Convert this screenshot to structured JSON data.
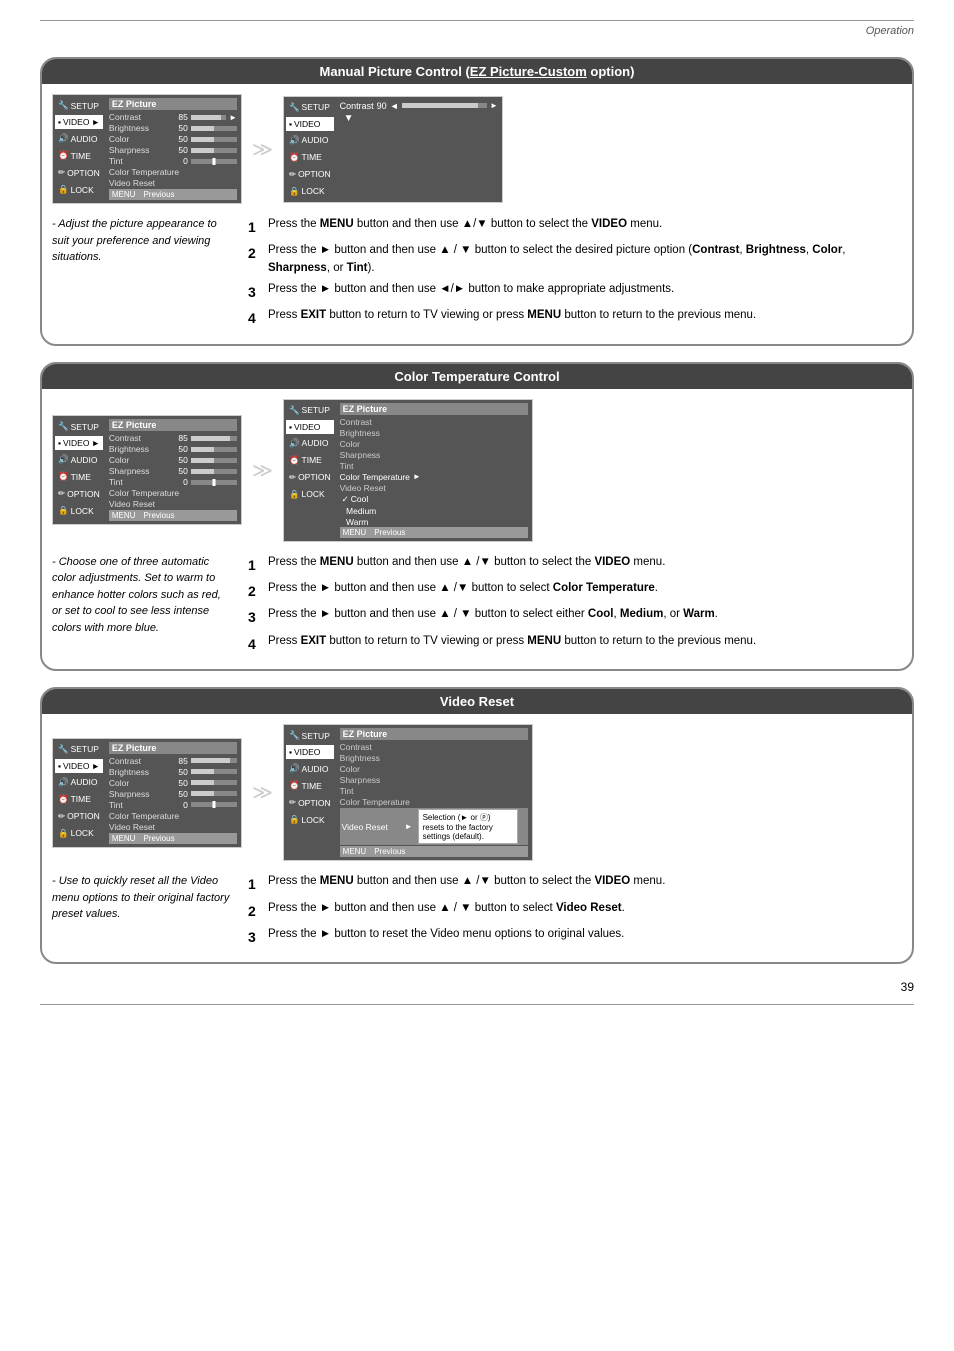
{
  "header": {
    "operation_label": "Operation"
  },
  "section1": {
    "title": "Manual Picture Control (EZ Picture-Custom option)",
    "left_panel": {
      "header": "EZ Picture",
      "rows": [
        {
          "label": "Contrast",
          "value": "85",
          "bar": 85
        },
        {
          "label": "Brightness",
          "value": "50",
          "bar": 50
        },
        {
          "label": "Color",
          "value": "50",
          "bar": 50
        },
        {
          "label": "Sharpness",
          "value": "50",
          "bar": 50
        },
        {
          "label": "Tint",
          "value": "0",
          "tint": true
        },
        {
          "label": "Color Temperature",
          "value": ""
        },
        {
          "label": "Video Reset",
          "value": ""
        }
      ],
      "bottom": [
        "MENU",
        "Previous"
      ],
      "sidebar": [
        {
          "label": "SETUP",
          "icon": "🔧"
        },
        {
          "label": "VIDEO",
          "selected": true
        },
        {
          "label": "AUDIO"
        },
        {
          "label": "TIME"
        },
        {
          "label": "OPTION"
        },
        {
          "label": "LOCK"
        }
      ]
    },
    "right_panel": {
      "contrast_label": "Contrast",
      "contrast_value": "90",
      "arrow_left": "◄",
      "arrow_right": "►",
      "bar_fill": 90,
      "down_arrow": "▼"
    },
    "side_note": "- Adjust the picture appearance to suit your preference and viewing situations.",
    "steps": [
      {
        "num": "1",
        "text": "Press the **MENU** button and then use ▲/▼ button to select the **VIDEO** menu."
      },
      {
        "num": "2",
        "text": "Press the ► button and then use ▲ / ▼ button to select the desired picture option (**Contrast**, **Brightness**, **Color**, **Sharpness**, or **Tint**)."
      },
      {
        "num": "3",
        "text": "Press the ► button and then use ◄/► button to make appropriate adjustments."
      },
      {
        "num": "4",
        "text": "Press **EXIT** button to return to TV viewing or press **MENU** button to return to the previous menu."
      }
    ]
  },
  "section2": {
    "title": "Color Temperature Control",
    "side_note": "- Choose one of three automatic color adjustments. Set to warm to enhance hotter colors such as red, or set to cool to see less intense colors with more blue.",
    "steps": [
      {
        "num": "1",
        "text": "Press the **MENU** button and then use ▲ /▼ button to select the **VIDEO** menu."
      },
      {
        "num": "2",
        "text": "Press the ► button and then use ▲ /▼ button to select **Color Temperature**."
      },
      {
        "num": "3",
        "text": "Press the ► button and then use ▲ / ▼ button to select either **Cool**, **Medium**, or **Warm**."
      },
      {
        "num": "4",
        "text": "Press **EXIT** button to return to TV viewing or press **MENU** button to return to the previous menu."
      }
    ],
    "right_options": [
      "✓ Cool",
      "Medium",
      "Warm"
    ]
  },
  "section3": {
    "title": "Video Reset",
    "side_note": "- Use to quickly reset all the Video menu options to their original factory preset values.",
    "steps": [
      {
        "num": "1",
        "text": "Press the **MENU** button and then use ▲ /▼ button to select the **VIDEO** menu."
      },
      {
        "num": "2",
        "text": "Press the ► button and then use ▲ / ▼ button to select **Video Reset**."
      },
      {
        "num": "3",
        "text": "Press the ► button to reset the Video menu options to original values."
      }
    ],
    "tooltip": "Selection (► or ⓟ) resets to the factory settings (default)."
  },
  "page_number": "39",
  "sidebar_labels": {
    "setup": "SETUP",
    "video": "VIDEO",
    "audio": "AUDIO",
    "time": "TIME",
    "option": "OPTION",
    "lock": "LOCK"
  }
}
